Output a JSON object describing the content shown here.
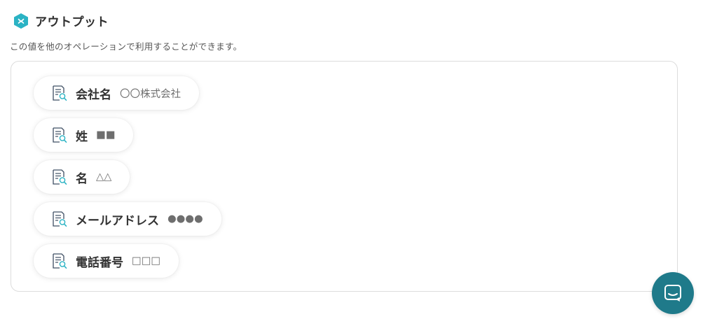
{
  "header": {
    "title": "アウトプット",
    "icon": "yoom-hex-logo-icon",
    "accent_color": "#2bb3c4"
  },
  "subtitle": "この値を他のオペレーションで利用することができます。",
  "outputs": [
    {
      "label": "会社名",
      "value": "〇〇株式会社",
      "icon": "document-search-icon"
    },
    {
      "label": "姓",
      "value": "■■",
      "icon": "document-search-icon"
    },
    {
      "label": "名",
      "value": "△△",
      "icon": "document-search-icon"
    },
    {
      "label": "メールアドレス",
      "value": "●●●●",
      "icon": "document-search-icon"
    },
    {
      "label": "電話番号",
      "value": "□□□",
      "icon": "document-search-icon"
    }
  ],
  "chat_widget": {
    "icon": "chat-bubble-icon",
    "color": "#1f7a8a"
  }
}
